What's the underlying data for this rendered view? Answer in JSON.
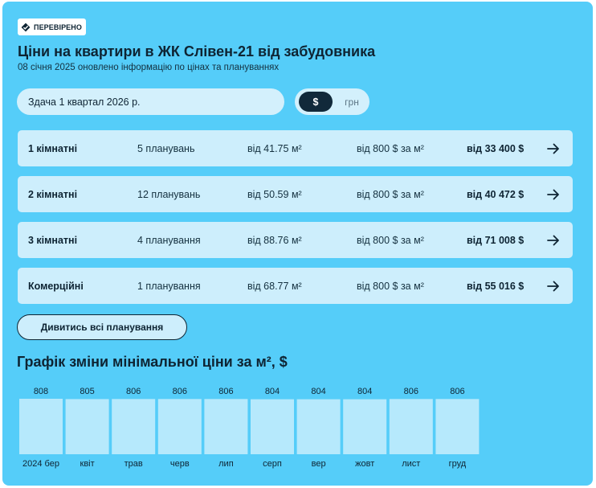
{
  "badge": {
    "label": "ПЕРЕВІРЕНО",
    "icon": "verified-check-icon"
  },
  "header": {
    "title": "Ціни на квартири в ЖК Слівен-21 від забудовника",
    "subtitle": "08 січня 2025 оновлено інформацію по цінах та плануваннях"
  },
  "filters": {
    "period": "Здача 1 квартал 2026 р.",
    "currency_options": [
      "$",
      "грн"
    ],
    "currency_selected": "$"
  },
  "rows": [
    {
      "type": "1 кімнатні",
      "plans": "5 планувань",
      "area": "від 41.75 м²",
      "price_per_sqm": "від 800 $ за м²",
      "price": "від 33 400 $"
    },
    {
      "type": "2 кімнатні",
      "plans": "12 планувань",
      "area": "від 50.59 м²",
      "price_per_sqm": "від 800 $ за м²",
      "price": "від 40 472 $"
    },
    {
      "type": "3 кімнатні",
      "plans": "4 планування",
      "area": "від 88.76 м²",
      "price_per_sqm": "від 800 $ за м²",
      "price": "від 71 008 $"
    },
    {
      "type": "Комерційні",
      "plans": "1 планування",
      "area": "від 68.77 м²",
      "price_per_sqm": "від 800 $ за м²",
      "price": "від 55 016 $"
    }
  ],
  "buttons": {
    "all_plans": "Дивитись всі планування"
  },
  "colors": {
    "background": "#55cdf9",
    "row": "#cdeefc",
    "bar": "#b6e9fc",
    "dark": "#0e2433"
  },
  "chart_data": {
    "type": "bar",
    "title": "Графік зміни мінімальної ціни за м², $",
    "categories": [
      "2024 бер",
      "квіт",
      "трав",
      "черв",
      "лип",
      "серп",
      "вер",
      "жовт",
      "лист",
      "груд"
    ],
    "values": [
      808,
      805,
      806,
      806,
      806,
      804,
      804,
      804,
      806,
      806
    ],
    "xlabel": "",
    "ylabel": "",
    "grid": false
  }
}
